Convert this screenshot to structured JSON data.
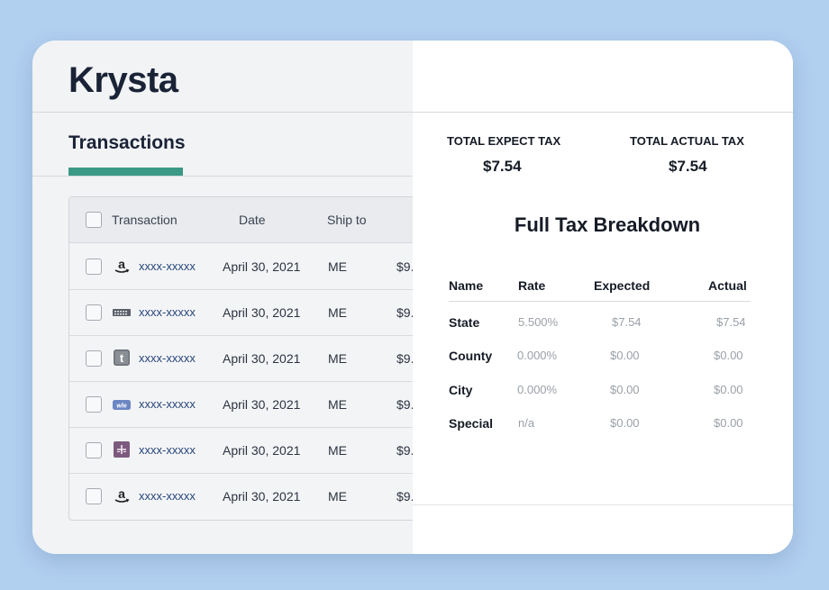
{
  "app": {
    "brand": "Krysta"
  },
  "tabs": [
    {
      "label": "Transactions",
      "active": true
    }
  ],
  "transactions_table": {
    "headers": {
      "transaction": "Transaction",
      "date": "Date",
      "ship_to": "Ship to"
    },
    "rows": [
      {
        "icon": "amazon-icon",
        "id": "xxxx-xxxxx",
        "date": "April 30, 2021",
        "ship_to": "ME",
        "amount": "$9."
      },
      {
        "icon": "store-grid-icon",
        "id": "xxxx-xxxxx",
        "date": "April 30, 2021",
        "ship_to": "ME",
        "amount": "$9."
      },
      {
        "icon": "t-square-icon",
        "id": "xxxx-xxxxx",
        "date": "April 30, 2021",
        "ship_to": "ME",
        "amount": "$9."
      },
      {
        "icon": "woo-icon",
        "id": "xxxx-xxxxx",
        "date": "April 30, 2021",
        "ship_to": "ME",
        "amount": "$9."
      },
      {
        "icon": "plus-grid-icon",
        "id": "xxxx-xxxxx",
        "date": "April 30, 2021",
        "ship_to": "ME",
        "amount": "$9."
      },
      {
        "icon": "amazon-icon",
        "id": "xxxx-xxxxx",
        "date": "April 30, 2021",
        "ship_to": "ME",
        "amount": "$9."
      }
    ]
  },
  "summary": {
    "expected_label": "TOTAL EXPECT TAX",
    "expected_value": "$7.54",
    "actual_label": "TOTAL ACTUAL TAX",
    "actual_value": "$7.54"
  },
  "breakdown": {
    "title": "Full Tax Breakdown",
    "headers": {
      "name": "Name",
      "rate": "Rate",
      "expected": "Expected",
      "actual": "Actual"
    },
    "rows": [
      {
        "name": "State",
        "rate": "5.500%",
        "expected": "$7.54",
        "actual": "$7.54"
      },
      {
        "name": "County",
        "rate": "0.000%",
        "expected": "$0.00",
        "actual": "$0.00"
      },
      {
        "name": "City",
        "rate": "0.000%",
        "expected": "$0.00",
        "actual": "$0.00"
      },
      {
        "name": "Special",
        "rate": "n/a",
        "expected": "$0.00",
        "actual": "$0.00"
      }
    ]
  },
  "colors": {
    "accent": "#3a9a85",
    "link": "#26457a",
    "background": "#b1cfef"
  }
}
